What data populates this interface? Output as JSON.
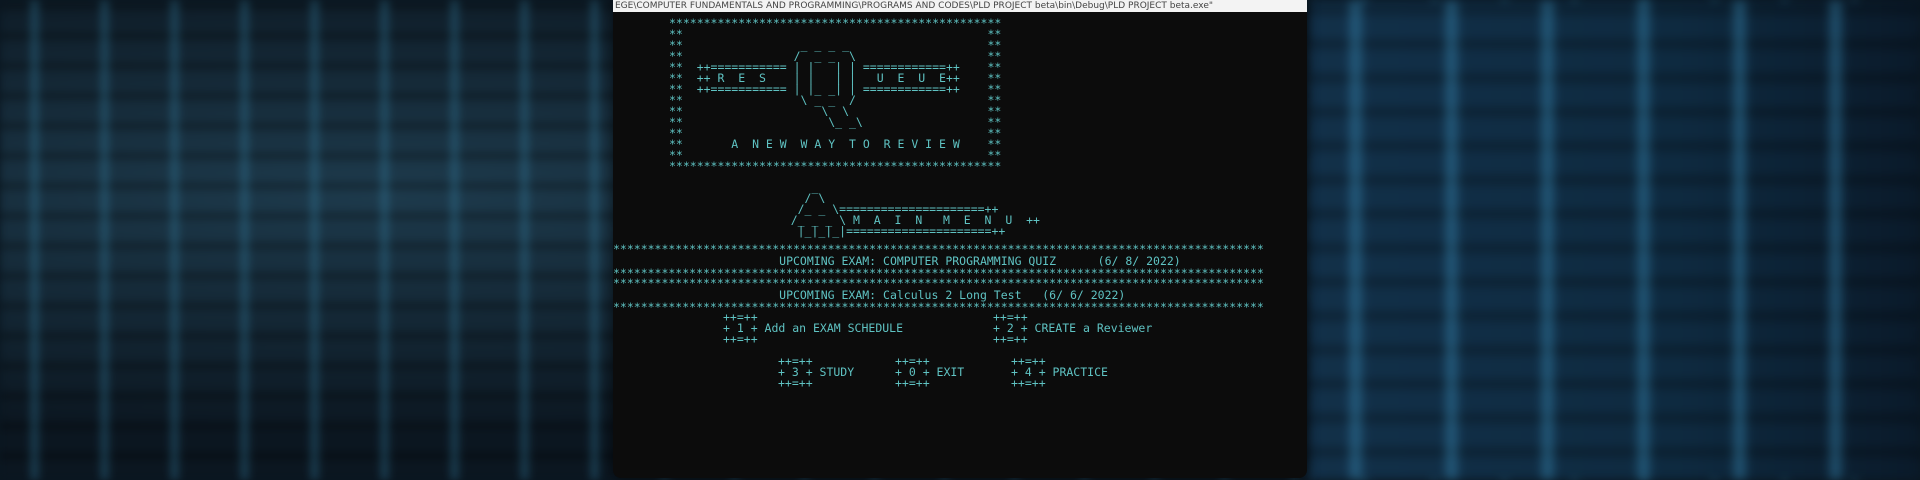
{
  "window": {
    "title": "EGE\\COMPUTER FUNDAMENTALS AND PROGRAMMING\\PROGRAMS AND CODES\\PLD PROJECT beta\\bin\\Debug\\PLD PROJECT beta.exe\""
  },
  "banner": {
    "row1": "************************************************",
    "row2": "**                                            **",
    "row3": "**                 _ _ _ _                    **",
    "row4": "**                /  _ _  \\                   **",
    "row5": "**  ++=========== | |   | | ============++    **",
    "row6": "**  ++ R  E  S    | |   | |   U  E  U  E++    **",
    "row7": "**  ++=========== | |_ _| | ============++    **",
    "row8": "**                 \\ _ _  /                   **",
    "row9": "**                    \\  \\                    **",
    "row10": "**                     \\_ _\\                  **",
    "row11": "**                                            **",
    "row12": "**       A  N E W  W A Y  T O  R E V I E W    **",
    "row13": "**                                            **",
    "row14": "************************************************"
  },
  "menu_art": {
    "row1": "       _",
    "row2": "      / \\",
    "row3": "     /_ _ \\=====================++",
    "row4": "    /_ _ _ \\ M  A  I  N   M  E  N  U  ++",
    "row5": "     |_|_|_|=====================++"
  },
  "exams": {
    "sep": "**********************************************************************************************",
    "exam1": "                        UPCOMING EXAM: COMPUTER PROGRAMMING QUIZ      (6/ 8/ 2022)",
    "exam2": "                        UPCOMING EXAM: Calculus 2 Long Test   (6/ 6/ 2022)"
  },
  "options": {
    "border": "++=++",
    "opt1": "+ 1 + Add an EXAM SCHEDULE",
    "opt2": "+ 2 + CREATE a Reviewer",
    "opt3": "+ 3 + STUDY",
    "opt0": "+ 0 + EXIT",
    "opt4": "+ 4 + PRACTICE"
  }
}
